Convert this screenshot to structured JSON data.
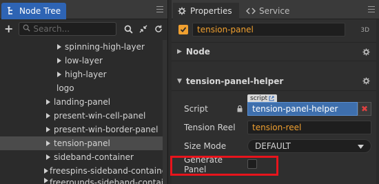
{
  "node_tree": {
    "tab_label": "Node Tree",
    "search_placeholder": "Search...",
    "items": [
      {
        "label": "spinning-high-layer",
        "has_children": true
      },
      {
        "label": "low-layer",
        "has_children": true
      },
      {
        "label": "high-layer",
        "has_children": true
      },
      {
        "label": "logo",
        "has_children": false
      },
      {
        "label": "landing-panel",
        "has_children": true
      },
      {
        "label": "present-win-cell-panel",
        "has_children": true
      },
      {
        "label": "present-win-border-panel",
        "has_children": true
      },
      {
        "label": "tension-panel",
        "has_children": true,
        "selected": true
      },
      {
        "label": "sideband-container",
        "has_children": true
      },
      {
        "label": "freespins-sideband-container",
        "has_children": true
      },
      {
        "label": "freerounds-sideband-contain",
        "has_children": true
      }
    ]
  },
  "properties": {
    "tab_label": "Properties",
    "service_tab_label": "Service",
    "node_name": "tension-panel",
    "badge_3d": "3D",
    "node_section_label": "Node",
    "component": {
      "title": "tension-panel-helper",
      "script_tag": "script",
      "script_label": "Script",
      "script_value": "tension-panel-helper",
      "tension_reel_label": "Tension Reel",
      "tension_reel_value": "tension-reel",
      "size_mode_label": "Size Mode",
      "size_mode_value": "DEFAULT",
      "generate_panel_label": "Generate Panel",
      "generate_panel_checked": false
    }
  },
  "colors": {
    "accent_blue": "#2e64b4",
    "accent_orange": "#f0a030",
    "highlight_red": "#e8141c"
  }
}
